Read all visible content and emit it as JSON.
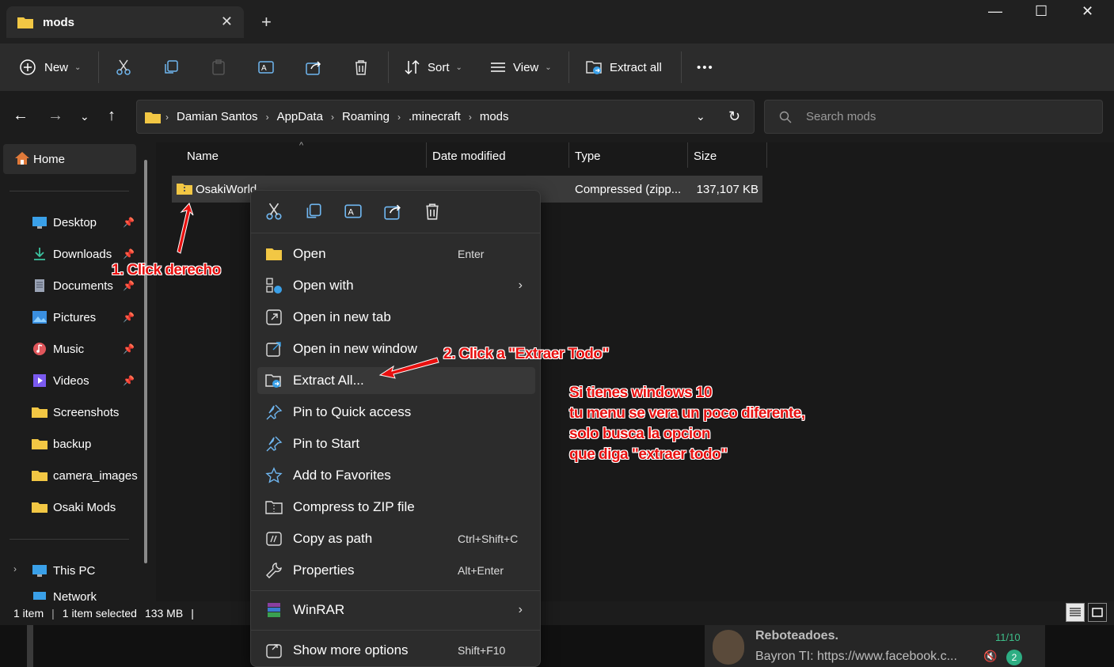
{
  "window": {
    "tab_title": "mods",
    "tab_close": "✕",
    "new_tab": "+",
    "minimize": "—",
    "maximize": "☐",
    "close": "✕"
  },
  "toolbar": {
    "new_label": "New",
    "sort_label": "Sort",
    "view_label": "View",
    "extract_all_label": "Extract all",
    "more_label": "•••"
  },
  "address": {
    "crumbs": [
      "Damian Santos",
      "AppData",
      "Roaming",
      ".minecraft",
      "mods"
    ],
    "search_placeholder": "Search mods"
  },
  "sidebar": {
    "home": "Home",
    "pinned": [
      {
        "label": "Desktop",
        "icon": "desktop-icon",
        "color": "#3aa0e8"
      },
      {
        "label": "Downloads",
        "icon": "download-icon",
        "color": "#3cc3a0"
      },
      {
        "label": "Documents",
        "icon": "document-icon",
        "color": "#9aa3b5"
      },
      {
        "label": "Pictures",
        "icon": "pictures-icon",
        "color": "#3a8fe0"
      },
      {
        "label": "Music",
        "icon": "music-icon",
        "color": "#e0565b"
      },
      {
        "label": "Videos",
        "icon": "videos-icon",
        "color": "#7a5af0"
      }
    ],
    "folders": [
      "Screenshots",
      "backup",
      "camera_images",
      "Osaki Mods"
    ],
    "this_pc": "This PC",
    "network": "Network"
  },
  "filelist": {
    "columns": [
      "Name",
      "Date modified",
      "Type",
      "Size"
    ],
    "rows": [
      {
        "name": "OsakiWorld",
        "date": "",
        "type": "Compressed (zipp...",
        "size": "137,107 KB"
      }
    ]
  },
  "status": {
    "count": "1 item",
    "selected": "1 item selected",
    "size": "133 MB"
  },
  "context_menu": {
    "items": [
      {
        "label": "Open",
        "key": "Enter",
        "icon": "folder-open-icon"
      },
      {
        "label": "Open with",
        "submenu": true,
        "icon": "open-with-icon"
      },
      {
        "label": "Open in new tab",
        "icon": "new-tab-icon"
      },
      {
        "label": "Open in new window",
        "icon": "new-window-icon"
      },
      {
        "label": "Extract All...",
        "icon": "extract-icon",
        "highlighted": true
      },
      {
        "label": "Pin to Quick access",
        "icon": "pin-icon"
      },
      {
        "label": "Pin to Start",
        "icon": "pin-start-icon"
      },
      {
        "label": "Add to Favorites",
        "icon": "star-icon"
      },
      {
        "label": "Compress to ZIP file",
        "icon": "zip-icon"
      },
      {
        "label": "Copy as path",
        "key": "Ctrl+Shift+C",
        "icon": "copy-path-icon"
      },
      {
        "label": "Properties",
        "key": "Alt+Enter",
        "icon": "wrench-icon"
      }
    ],
    "winrar": "WinRAR",
    "more_options": "Show more options",
    "more_options_key": "Shift+F10"
  },
  "annotations": {
    "step1": "1. Click derecho",
    "step2": "2. Click a \"Extraer Todo\"",
    "note_line1": "Si tienes windows 10",
    "note_line2": "tu menu se vera un poco diferente,",
    "note_line3": "solo busca la opcion",
    "note_line4": "que diga \"extraer todo\""
  },
  "notification": {
    "title": "Reboteadoes.",
    "time": "11/10",
    "preview": "Bayron TI: https://www.facebook.c...",
    "badge": "2"
  },
  "colors": {
    "folder": "#f2c744",
    "annotation_red": "#e8100f",
    "accent": "#3aa0e8"
  }
}
